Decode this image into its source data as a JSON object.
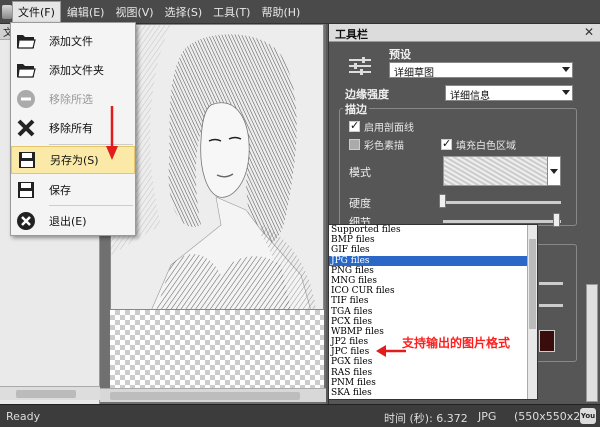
{
  "menubar": {
    "items": [
      "文件(F)",
      "编辑(E)",
      "视图(V)",
      "选择(S)",
      "工具(T)",
      "帮助(H)"
    ]
  },
  "left_panel": {
    "header": "文"
  },
  "file_menu": {
    "items": [
      {
        "label": "添加文件",
        "icon": "folder-open-icon",
        "disabled": false
      },
      {
        "label": "添加文件夹",
        "icon": "folder-icon",
        "disabled": false
      },
      {
        "label": "移除所选",
        "icon": "minus-circle-icon",
        "disabled": true
      },
      {
        "label": "移除所有",
        "icon": "x-icon",
        "disabled": false
      },
      {
        "label": "另存为(S)",
        "icon": "save-as-icon",
        "disabled": false,
        "highlight": true
      },
      {
        "label": "保存",
        "icon": "save-icon",
        "disabled": false
      },
      {
        "label": "退出(E)",
        "icon": "exit-icon",
        "disabled": false
      }
    ]
  },
  "toolpanel": {
    "title": "工具栏",
    "preset_label": "预设",
    "preset_value": "详细草图",
    "edge_strength_label": "边缘强度",
    "edge_strength_value": "详细信息",
    "stroke_group_label": "描边",
    "use_hatching": "启用剖面线",
    "colored_pencil": "彩色素描",
    "fill_white": "填充白色区域",
    "mode_label": "模式",
    "hardness_label": "硬度",
    "detail_label": "细节"
  },
  "format_list": {
    "items": [
      "Supported files",
      "BMP files",
      "GIF files",
      "JPG files",
      "PNG files",
      "MNG files",
      "ICO CUR files",
      "TIF files",
      "TGA files",
      "PCX files",
      "WBMP files",
      "JP2 files",
      "JPC files",
      "PGX files",
      "RAS files",
      "PNM files",
      "SKA files"
    ],
    "selected": "JPG files"
  },
  "annotation": "支持输出的图片格式",
  "statusbar": {
    "status": "Ready",
    "time_label": "时间 (秒): 6.372",
    "format": "JPG",
    "dims": "(550x550x24"
  },
  "colors": {
    "accent_red": "#ff1e1e",
    "selection_blue": "#2a67c6",
    "highlight_yellow": "#fbe9a8"
  }
}
